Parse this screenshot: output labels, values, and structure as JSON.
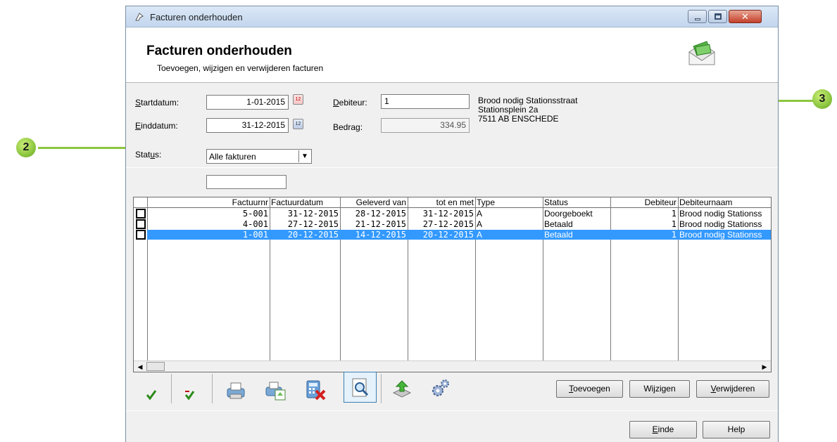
{
  "window": {
    "title": "Facturen onderhouden"
  },
  "header": {
    "title": "Facturen onderhouden",
    "subtitle": "Toevoegen, wijzigen en verwijderen facturen",
    "icon": "envelope-money-icon"
  },
  "filters": {
    "startdatum_label_u": "S",
    "startdatum_label_rest": "tartdatum:",
    "startdatum_value": "1-01-2015",
    "einddatum_label_u": "E",
    "einddatum_label_rest": "inddatum:",
    "einddatum_value": "31-12-2015",
    "status_label_pre": "Stat",
    "status_label_u": "u",
    "status_label_post": "s:",
    "status_value": "Alle fakturen",
    "debiteur_label_u": "D",
    "debiteur_label_rest": "ebiteur:",
    "debiteur_value": "1",
    "bedrag_label": "Bedrag:",
    "bedrag_value": "334.95",
    "debtor_name": "Brood nodig Stationsstraat",
    "debtor_street": "Stationsplein 2a",
    "debtor_city": "7511 AB ENSCHEDE",
    "search_value": ""
  },
  "table": {
    "columns": [
      "Factuurnr",
      "Factuurdatum",
      "Geleverd van",
      "tot en met",
      "Type",
      "Status",
      "Debiteur",
      "Debiteurnaam"
    ],
    "rows": [
      {
        "factuurnr": "5-001",
        "factuurdatum": "31-12-2015",
        "geleverd_van": "28-12-2015",
        "tot_en_met": "31-12-2015",
        "type": "A",
        "status": "Doorgeboekt",
        "debiteur": "1",
        "debiteurnaam": "Brood nodig Stationss",
        "selected": false
      },
      {
        "factuurnr": "4-001",
        "factuurdatum": "27-12-2015",
        "geleverd_van": "21-12-2015",
        "tot_en_met": "27-12-2015",
        "type": "A",
        "status": "Betaald",
        "debiteur": "1",
        "debiteurnaam": "Brood nodig Stationss",
        "selected": false
      },
      {
        "factuurnr": "1-001",
        "factuurdatum": "20-12-2015",
        "geleverd_van": "14-12-2015",
        "tot_en_met": "20-12-2015",
        "type": "A",
        "status": "Betaald",
        "debiteur": "1",
        "debiteurnaam": "Brood nodig Stationss",
        "selected": true
      }
    ]
  },
  "toolbar": {
    "icons": [
      "check-icon",
      "check-minus-icon",
      "printer-icon",
      "print-preview-icon",
      "calculator-delete-icon",
      "search-document-icon",
      "export-up-icon",
      "settings-gears-icon"
    ],
    "toevoegen_u": "T",
    "toevoegen_rest": "oevoegen",
    "wijzigen_label": "Wijzigen",
    "verwijderen_u": "V",
    "verwijderen_rest": "erwijderen",
    "einde_u": "E",
    "einde_rest": "inde",
    "help_label": "Help"
  },
  "callouts": {
    "c2": "2",
    "c3": "3"
  },
  "colors": {
    "selection": "#3399ff",
    "callout": "#8cc63f"
  }
}
